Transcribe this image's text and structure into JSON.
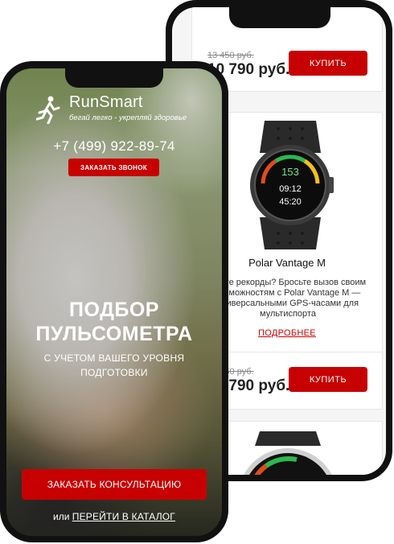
{
  "catalog": {
    "products": [
      {
        "old_price": "13 450 руб.",
        "new_price": "10 790 руб.",
        "buy_label": "КУПИТЬ"
      },
      {
        "watch_display": {
          "top_value": "153",
          "mid_value": "09:12",
          "bottom_value": "45:20"
        },
        "title": "Polar Vantage M",
        "description": "Бьете рекорды? Бросьте вызов своим возможностям с Polar Vantage M — универсальными GPS-часами для мультиспорта",
        "more_label": "ПОДРОБНЕЕ",
        "old_price": "13 450 руб.",
        "new_price": "10 790 руб.",
        "buy_label": "КУПИТЬ"
      }
    ]
  },
  "landing": {
    "brand_name": "RunSmart",
    "brand_tagline": "бегай легко - укрепляй здоровье",
    "phone": "+7 (499) 922-89-74",
    "callback_label": "ЗАКАЗАТЬ ЗВОНОК",
    "hero_title_line1": "ПОДБОР",
    "hero_title_line2": "ПУЛЬСОМЕТРА",
    "hero_subtitle": "С УЧЕТОМ ВАШЕГО УРОВНЯ ПОДГОТОВКИ",
    "consult_label": "ЗАКАЗАТЬ КОНСУЛЬТАЦИЮ",
    "or_label": "или",
    "catalog_link": "ПЕРЕЙТИ В КАТАЛОГ"
  },
  "colors": {
    "accent_red": "#c70101",
    "phone_frame": "#111111"
  },
  "icons": [
    "runner-logo-icon",
    "smartwatch-image"
  ]
}
